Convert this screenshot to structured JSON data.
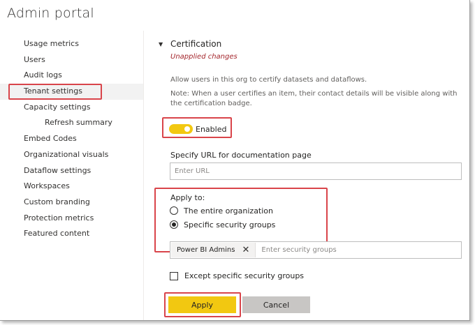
{
  "window": {
    "title": "Admin portal"
  },
  "sidebar": {
    "items": [
      {
        "label": "Usage metrics"
      },
      {
        "label": "Users"
      },
      {
        "label": "Audit logs"
      },
      {
        "label": "Tenant settings",
        "selected": true
      },
      {
        "label": "Capacity settings"
      },
      {
        "label": "Refresh summary",
        "sub": true
      },
      {
        "label": "Embed Codes"
      },
      {
        "label": "Organizational visuals"
      },
      {
        "label": "Dataflow settings"
      },
      {
        "label": "Workspaces"
      },
      {
        "label": "Custom branding"
      },
      {
        "label": "Protection metrics"
      },
      {
        "label": "Featured content"
      }
    ]
  },
  "section": {
    "caret_icon": "triangle-down-icon",
    "title": "Certification",
    "status": "Unapplied changes",
    "description": "Allow users in this org to certify datasets and dataflows.",
    "note": "Note: When a user certifies an item, their contact details will be visible along with the certification badge.",
    "toggle": {
      "label": "Enabled",
      "on": true,
      "color": "#f2c811"
    },
    "url": {
      "label": "Specify URL for documentation page",
      "placeholder": "Enter URL",
      "value": ""
    },
    "apply_to": {
      "label": "Apply to:",
      "options": [
        {
          "label": "The entire organization",
          "checked": false
        },
        {
          "label": "Specific security groups",
          "checked": true
        }
      ]
    },
    "groups": {
      "chip": "Power BI Admins",
      "chip_remove_icon": "close-icon",
      "placeholder": "Enter security groups"
    },
    "except": {
      "label": "Except specific security groups",
      "checked": false
    },
    "buttons": {
      "apply": "Apply",
      "cancel": "Cancel"
    }
  },
  "colors": {
    "accent": "#f2c811",
    "highlight": "#d9444a",
    "warning_text": "#a4262c"
  }
}
